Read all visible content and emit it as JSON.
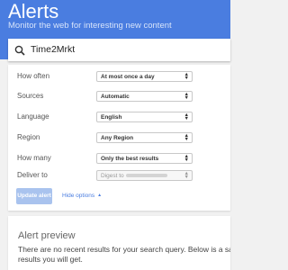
{
  "header": {
    "title": "Alerts",
    "subtitle": "Monitor the web for interesting new content"
  },
  "search": {
    "value": "Time2Mrkt"
  },
  "options": [
    {
      "label": "How often",
      "value": "At most once a day"
    },
    {
      "label": "Sources",
      "value": "Automatic"
    },
    {
      "label": "Language",
      "value": "English"
    },
    {
      "label": "Region",
      "value": "Any Region"
    },
    {
      "label": "How many",
      "value": "Only the best results"
    },
    {
      "label": "Deliver to",
      "value": "Digest to"
    }
  ],
  "actions": {
    "update_label": "Update alert",
    "hide_options_label": "Hide options"
  },
  "preview": {
    "title": "Alert preview",
    "line1": "There are no recent results for your search query. Below is a samp",
    "line2": "results you will get."
  },
  "colors": {
    "header_bg": "#4a7de0",
    "button_disabled": "#a9c3ee",
    "link": "#4a7de0"
  }
}
